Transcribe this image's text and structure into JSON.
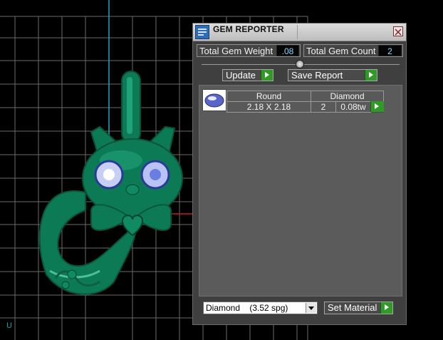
{
  "window": {
    "title": "GEM REPORTER",
    "close_icon": "close-icon"
  },
  "stats": {
    "total_weight_label": "Total Gem Weight",
    "total_weight_value": ".08",
    "total_count_label": "Total Gem Count",
    "total_count_value": "2"
  },
  "buttons": {
    "update_label": "Update",
    "save_report_label": "Save Report",
    "set_material_label": "Set Material"
  },
  "gem_table": {
    "rows": [
      {
        "icon": "round-gem-icon",
        "shape": "Round",
        "material": "Diamond",
        "size": "2.18 X 2.18",
        "count": "2",
        "weight": "0.08tw"
      }
    ]
  },
  "material_select": {
    "selected": "Diamond    (3.52 spg)"
  },
  "colors": {
    "accent_go": "#2f9a25",
    "value_text": "#8fd7ff",
    "model_green": "#0b7a55",
    "grid": "#6b6b6b"
  }
}
